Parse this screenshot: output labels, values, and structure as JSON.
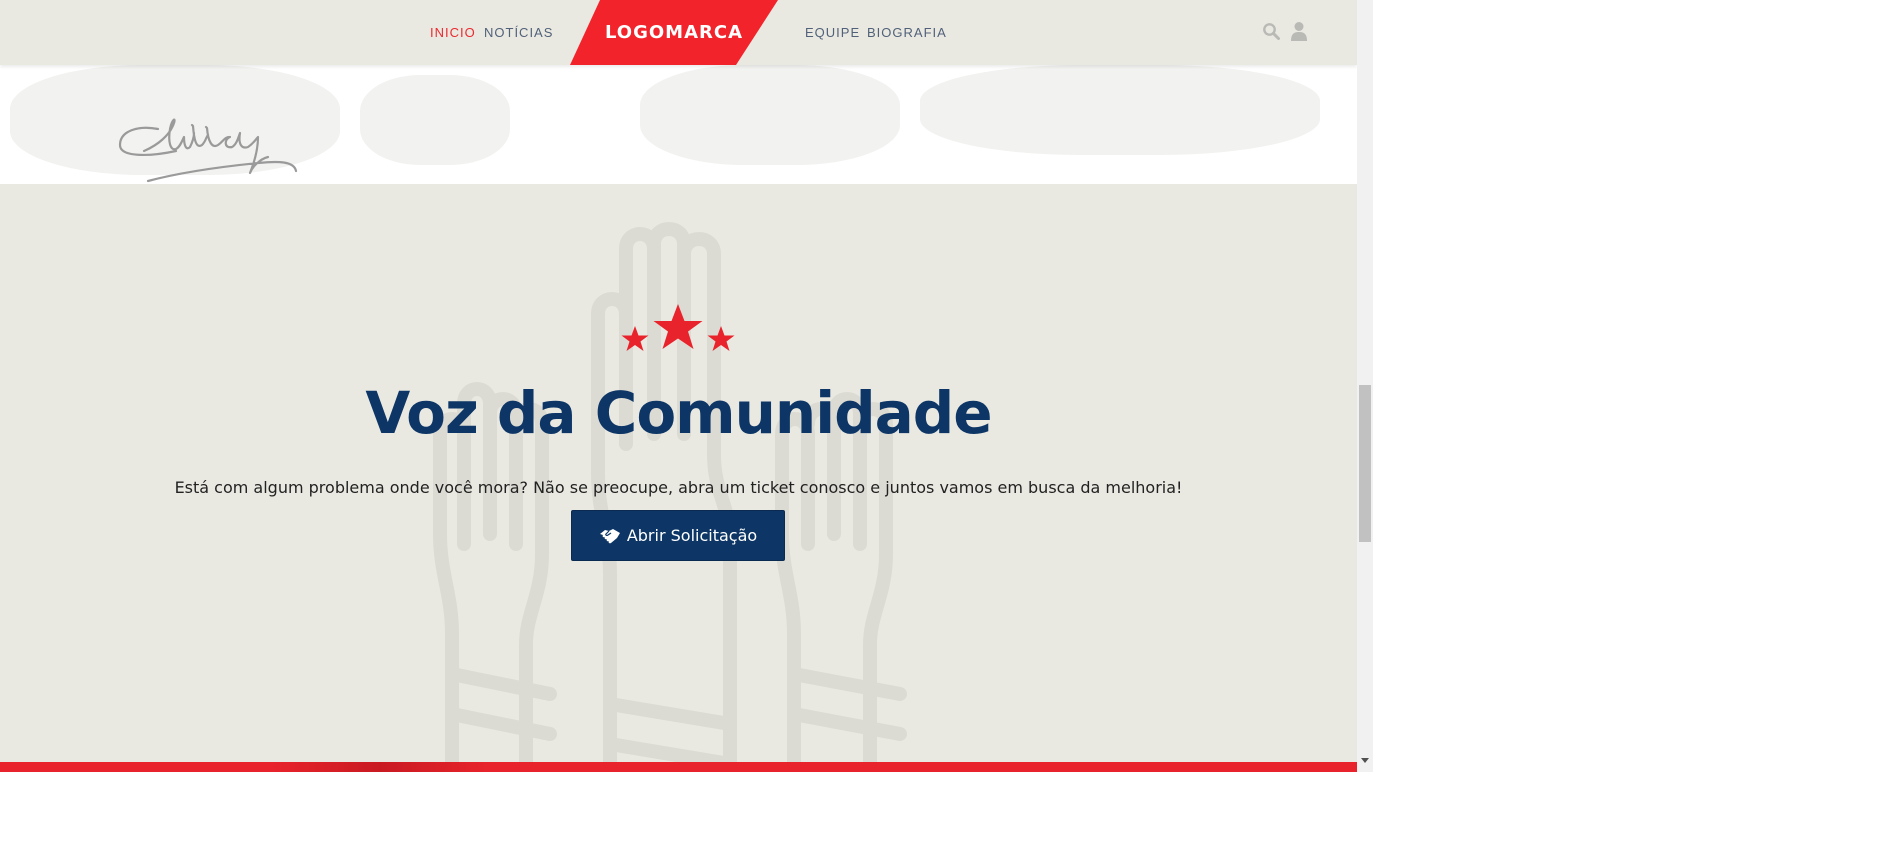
{
  "header": {
    "nav_left": [
      "INICIO",
      "NOTÍCIAS"
    ],
    "nav_right": [
      "EQUIPE",
      "BIOGRAFIA"
    ],
    "logo": "LOGOMARCA",
    "active_color": "#ea2a30",
    "link_color": "#51617a",
    "logo_color": "#f2232b"
  },
  "icons": {
    "search": "search-icon",
    "user": "user-icon",
    "stars": "stars-icon",
    "cta": "handshake-icon"
  },
  "community": {
    "title": "Voz da Comunidade",
    "description": "Está com algum problema onde você mora? Não se preocupe, abra um ticket conosco e juntos vamos em busca da melhoria!",
    "button_label": "Abrir Solicitação",
    "title_color": "#0d3566",
    "background": "#eae9e1",
    "accent": "#e8232b"
  }
}
